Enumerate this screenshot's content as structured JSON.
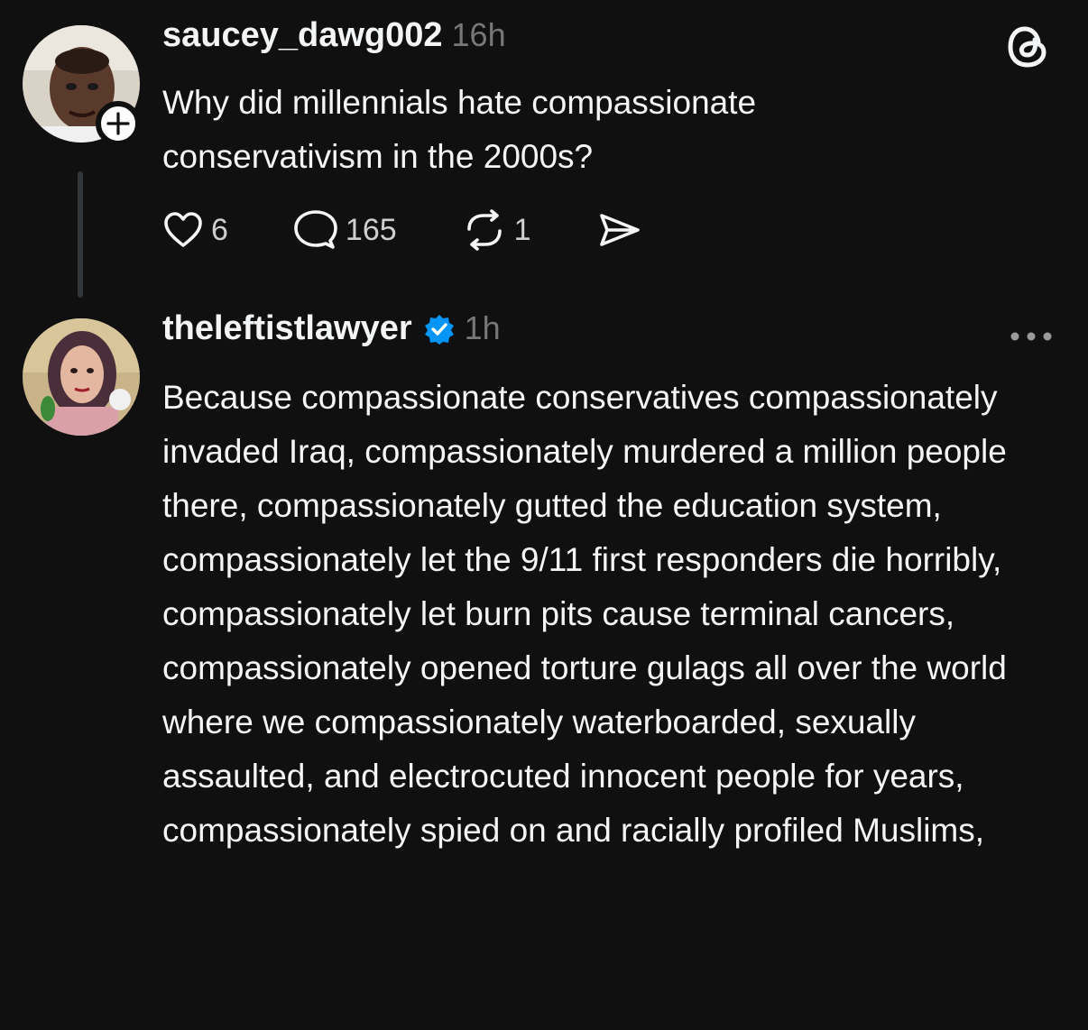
{
  "app": {
    "logo_icon": "threads-logo-icon"
  },
  "post": {
    "username": "saucey_dawg002",
    "timestamp": "16h",
    "text": "Why did millennials hate compassionate conservativism in the 2000s?",
    "actions": {
      "likes": "6",
      "replies": "165",
      "reposts": "1"
    }
  },
  "reply": {
    "username": "theleftistlawyer",
    "verified": true,
    "timestamp": "1h",
    "text": "Because compassionate conservatives compassionately invaded Iraq, compassionately murdered a million people there, compassionately gutted the education system, compassionately let the 9/11 first responders die horribly, compassionately let burn pits cause terminal cancers, compassionately opened torture gulags all over the world where we compassionately waterboarded, sexually assaulted, and electrocuted innocent people for years, compassionately spied on and racially profiled Muslims,"
  },
  "colors": {
    "background": "#101010",
    "text": "#f3f5f7",
    "muted": "#777777",
    "verified": "#0095f6"
  }
}
